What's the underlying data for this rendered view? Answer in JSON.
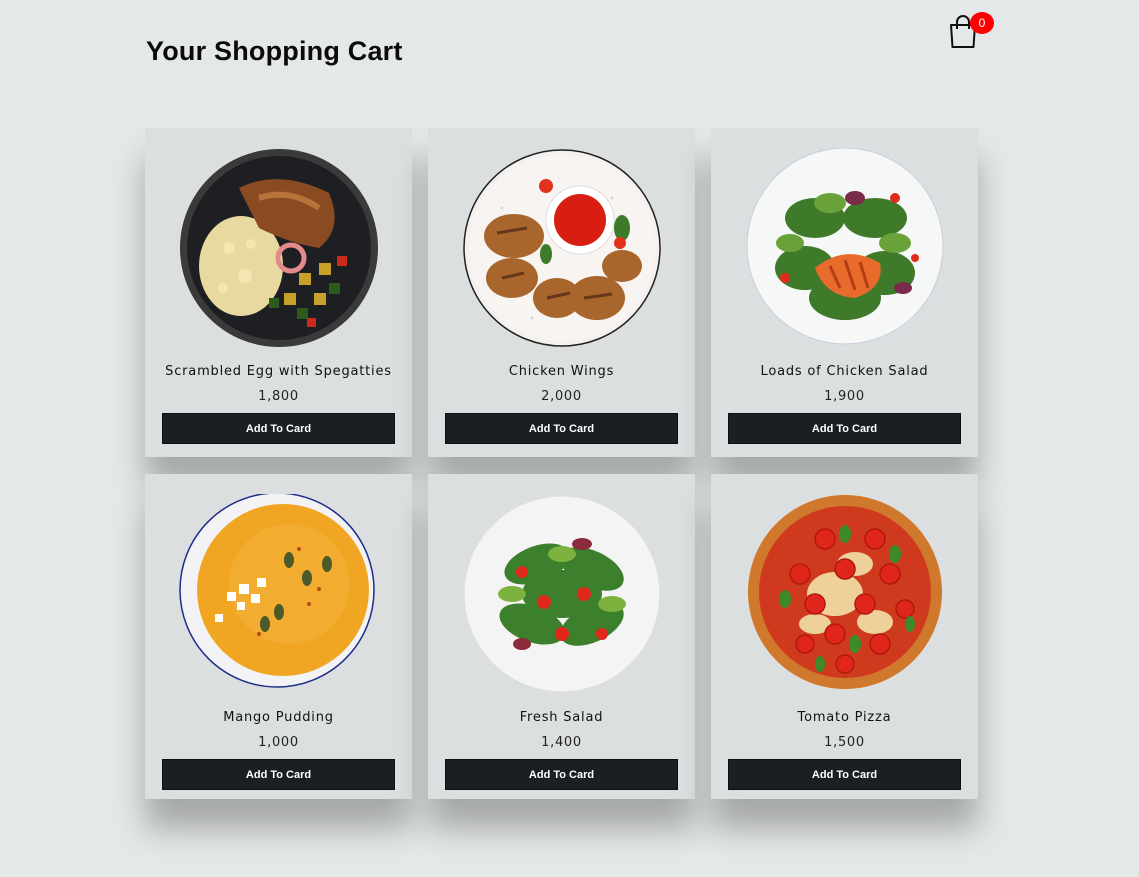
{
  "header": {
    "title": "Your Shopping Cart",
    "cart_icon": "shopping-bag-icon",
    "cart_count": "0",
    "badge_color": "#ff0000"
  },
  "products": [
    {
      "name": "Scrambled Egg with Spegatties",
      "price": "1,800",
      "button": "Add To Card",
      "image": "egg-spaghetti-bowl"
    },
    {
      "name": "Chicken Wings",
      "price": "2,000",
      "button": "Add To Card",
      "image": "chicken-wings-plate"
    },
    {
      "name": "Loads of Chicken Salad",
      "price": "1,900",
      "button": "Add To Card",
      "image": "chicken-salad-plate"
    },
    {
      "name": "Mango Pudding",
      "price": "1,000",
      "button": "Add To Card",
      "image": "mango-pudding-bowl"
    },
    {
      "name": "Fresh Salad",
      "price": "1,400",
      "button": "Add To Card",
      "image": "fresh-salad-plate"
    },
    {
      "name": "Tomato Pizza",
      "price": "1,500",
      "button": "Add To Card",
      "image": "tomato-pizza"
    }
  ],
  "colors": {
    "background": "#e5e8e9",
    "card": "#dcdfe0",
    "button": "#1b1e23"
  }
}
